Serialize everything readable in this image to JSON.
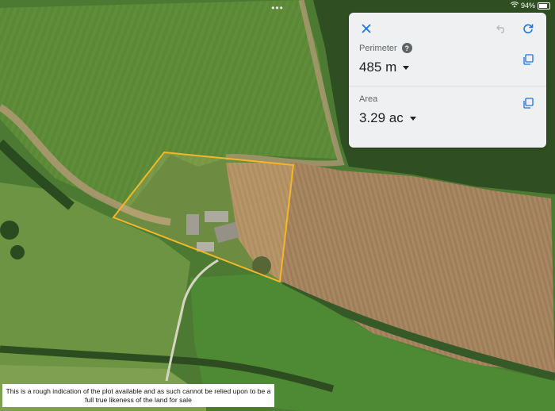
{
  "status": {
    "battery": "94%"
  },
  "panel": {
    "perimeter": {
      "label": "Perimeter",
      "value": "485 m"
    },
    "area": {
      "label": "Area",
      "value": "3.29 ac"
    }
  },
  "disclaimer": "This is a rough indication of the plot available and as such cannot be relied upon to be a full true likeness of the land for sale",
  "colors": {
    "outline": "#f4b728",
    "accent": "#1a73e8"
  }
}
